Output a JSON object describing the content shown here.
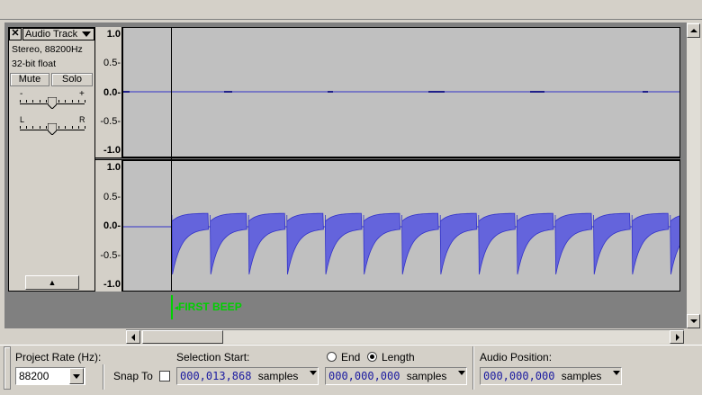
{
  "track": {
    "close_glyph": "✕",
    "name": "Audio Track",
    "format": "Stereo, 88200Hz",
    "bit_depth": "32-bit float",
    "mute_label": "Mute",
    "solo_label": "Solo",
    "gain_minus": "-",
    "gain_plus": "+",
    "pan_left": "L",
    "pan_right": "R",
    "gain_level": 0.5,
    "pan_level": 0.5,
    "collapse_glyph": "▲"
  },
  "ruler": {
    "top_channel": [
      "1.0",
      "0.5-",
      "0.0-",
      "-0.5-",
      "-1.0"
    ],
    "bottom_channel": [
      "1.0",
      "0.5-",
      "0.0-",
      "-0.5-",
      "-1.0"
    ]
  },
  "label_track": {
    "label_text": "FIRST BEEP"
  },
  "toolbar": {
    "project_rate_label": "Project Rate (Hz):",
    "project_rate_value": "88200",
    "snap_to_label": "Snap To",
    "selection_start_label": "Selection Start:",
    "selection_start_value": "000,013,868",
    "selection_start_unit": "samples",
    "end_label": "End",
    "length_label": "Length",
    "selected_mode": "Length",
    "length_value": "000,000,000",
    "length_unit": "samples",
    "audio_position_label": "Audio Position:",
    "audio_position_value": "000,000,000",
    "audio_position_unit": "samples"
  },
  "colors": {
    "waveform": "#3232c8",
    "waveform_fill": "#6464dc",
    "label": "#00d000"
  }
}
